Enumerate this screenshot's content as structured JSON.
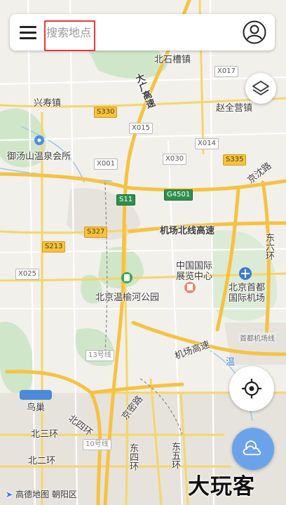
{
  "search": {
    "placeholder": "搜索地点"
  },
  "map": {
    "place_labels": {
      "beishicaozhen": "北石槽镇",
      "xingshouzhen": "兴寿镇",
      "zhaoquanyingzhen": "赵全营镇",
      "yutangshan": "御汤山温泉会所",
      "jingshenlu": "京沈路",
      "airport_north_line": "机场北线高速",
      "dongliuhuan": "东六环",
      "expo_center": "中国国际展览中心",
      "capital_airport": "北京首都国际机场",
      "wenyuhe_park": "北京温榆河公园",
      "airport_expressway": "机场高速",
      "airport_expressway_short": "首都机场线",
      "jingmi_road": "京密路",
      "niaochao": "鸟巢",
      "beisihuan": "北四环",
      "beisanhuan": "北三环",
      "beierhuan": "北二环",
      "dongsihuan": "东四环",
      "dongwuhuan": "东五环",
      "damen_gaosu": "大广高速",
      "line13": "13号线",
      "line10": "10号线",
      "chaoyang": "朝阳区",
      "wenyu": "温"
    },
    "road_shields": {
      "s330": "S330",
      "s335": "S335",
      "s11": "S11",
      "g4501": "G4501",
      "s327": "S327",
      "s213": "S213",
      "x017": "X017",
      "x015": "X015",
      "x014": "X014",
      "x001": "X001",
      "x030": "X030",
      "x025": "X025"
    }
  },
  "footer": {
    "logo_text": "高德地图",
    "district": "朝阳区"
  },
  "watermark": "大玩客",
  "colors": {
    "highlight": "#e23a3a",
    "weather_bg": "#6aa3ea",
    "expressway": "#f6c243"
  },
  "icons": {
    "menu": "hamburger-icon",
    "user": "user-icon",
    "layers": "layers-icon",
    "locate": "locate-icon",
    "weather": "weather-cloud-icon"
  }
}
